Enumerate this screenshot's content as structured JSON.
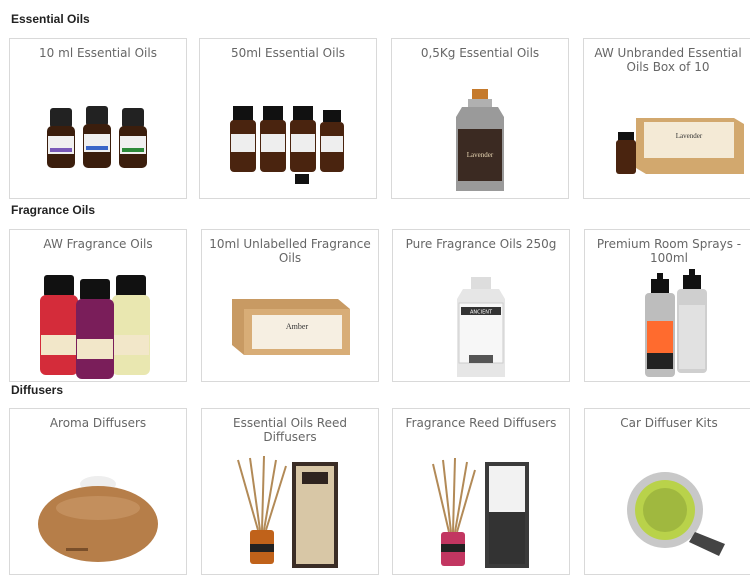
{
  "sections": [
    {
      "title": "Essential Oils",
      "products": [
        {
          "name": "10 ml Essential Oils",
          "icon": "three-small-bottles-icon"
        },
        {
          "name": "50ml Essential Oils",
          "icon": "four-amber-bottles-icon"
        },
        {
          "name": "0,5Kg Essential Oils",
          "icon": "tin-bottle-icon"
        },
        {
          "name": "AW Unbranded Essential Oils Box of 10",
          "icon": "bottle-and-box-icon"
        }
      ]
    },
    {
      "title": "Fragrance Oils",
      "products": [
        {
          "name": "AW Fragrance Oils",
          "icon": "colored-bottles-icon"
        },
        {
          "name": "10ml Unlabelled Fragrance Oils",
          "icon": "cardboard-box-icon"
        },
        {
          "name": "Pure Fragrance Oils 250g",
          "icon": "white-bottle-icon"
        },
        {
          "name": "Premium Room Sprays - 100ml",
          "icon": "spray-bottles-icon"
        }
      ]
    },
    {
      "title": "Diffusers",
      "products": [
        {
          "name": "Aroma Diffusers",
          "icon": "wooden-diffuser-icon"
        },
        {
          "name": "Essential Oils Reed Diffusers",
          "icon": "reed-diffuser-icon"
        },
        {
          "name": "Fragrance Reed Diffusers",
          "icon": "pink-reed-diffuser-icon"
        },
        {
          "name": "Car Diffuser Kits",
          "icon": "car-diffuser-icon"
        }
      ]
    }
  ],
  "labels": {
    "ancient": "ANCIENT",
    "lavender": "Lavender",
    "amber": "Amber"
  },
  "colors": {
    "border": "#d9d9d9",
    "amber_glass": "#5a2d12",
    "section_text": "#222222"
  }
}
